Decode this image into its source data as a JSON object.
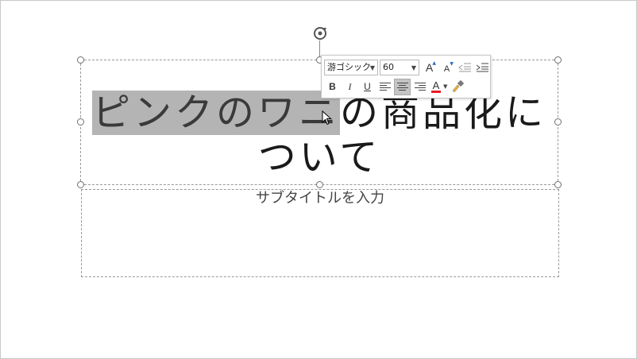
{
  "slide": {
    "title_selected": "ピンクのワニ",
    "title_rest": "の商品化に",
    "title_line2": "ついて",
    "subtitle_placeholder": "サブタイトルを入力"
  },
  "mini_toolbar": {
    "font_name": "游ゴシック",
    "font_size": "60",
    "grow_font_label": "A",
    "shrink_font_label": "A",
    "bold_label": "B",
    "italic_label": "I",
    "underline_label": "U",
    "font_color_label": "A",
    "font_color": "#e81b23",
    "icons": [
      "decrease-indent-icon",
      "increase-indent-icon",
      "align-left-icon",
      "align-center-icon",
      "align-right-icon",
      "format-painter-icon"
    ]
  }
}
